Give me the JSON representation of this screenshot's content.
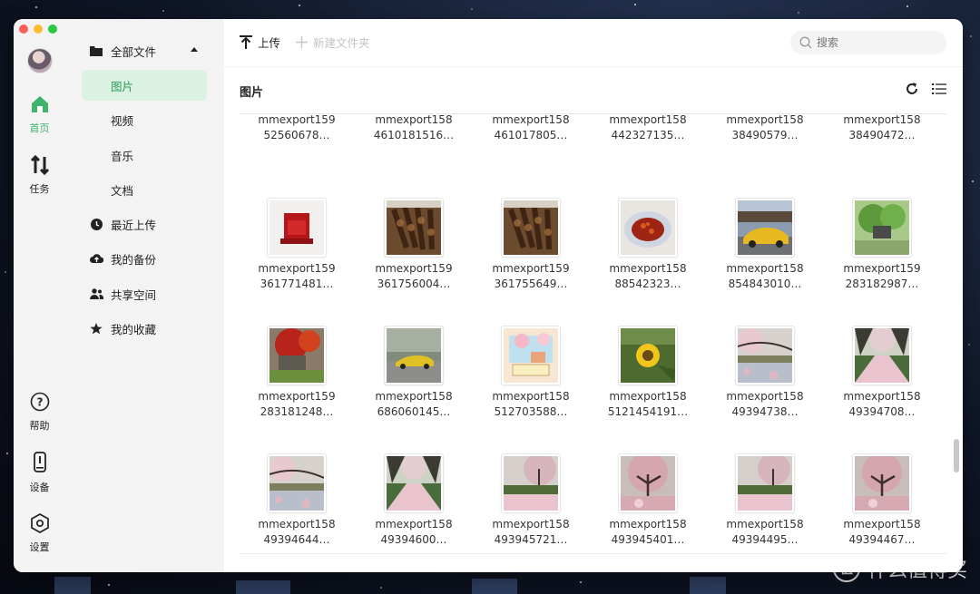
{
  "window": {
    "traffic_colors": [
      "#ff5f57",
      "#febc2e",
      "#28c840"
    ]
  },
  "rail": {
    "items": [
      {
        "label": "首页",
        "icon": "home-icon",
        "active": true
      },
      {
        "label": "任务",
        "icon": "transfer-icon",
        "active": false
      },
      {
        "label": "帮助",
        "icon": "help-icon",
        "active": false
      },
      {
        "label": "设备",
        "icon": "device-icon",
        "active": false
      },
      {
        "label": "设置",
        "icon": "settings-hex-icon",
        "active": false
      }
    ]
  },
  "sidebar": {
    "items": [
      {
        "label": "全部文件",
        "icon": "folder-icon"
      },
      {
        "label": "图片",
        "selected": true
      },
      {
        "label": "视频"
      },
      {
        "label": "音乐"
      },
      {
        "label": "文档"
      },
      {
        "label": "最近上传",
        "icon": "clock-icon"
      },
      {
        "label": "我的备份",
        "icon": "cloud-upload-icon"
      },
      {
        "label": "共享空间",
        "icon": "users-icon"
      },
      {
        "label": "我的收藏",
        "icon": "star-icon"
      }
    ]
  },
  "toolbar": {
    "upload_label": "上传",
    "new_folder_label": "新建文件夹",
    "search_placeholder": "搜索"
  },
  "main": {
    "section_title": "图片",
    "partial_row": [
      {
        "line1": "mmexport159",
        "line2": "52560678…"
      },
      {
        "line1": "mmexport158",
        "line2": "4610181516…"
      },
      {
        "line1": "mmexport158",
        "line2": "461017805…"
      },
      {
        "line1": "mmexport158",
        "line2": "442327135…"
      },
      {
        "line1": "mmexport158",
        "line2": "38490579…"
      },
      {
        "line1": "mmexport158",
        "line2": "38490472…"
      }
    ],
    "files": [
      {
        "line1": "mmexport159",
        "line2": "361771481…",
        "scene": "red-box"
      },
      {
        "line1": "mmexport159",
        "line2": "361756004…",
        "scene": "skewers"
      },
      {
        "line1": "mmexport159",
        "line2": "361755649…",
        "scene": "skewers"
      },
      {
        "line1": "mmexport158",
        "line2": "88542323…",
        "scene": "dish"
      },
      {
        "line1": "mmexport158",
        "line2": "854843010…",
        "scene": "yellow-car"
      },
      {
        "line1": "mmexport159",
        "line2": "283182987…",
        "scene": "park"
      },
      {
        "line1": "mmexport159",
        "line2": "283181248…",
        "scene": "red-tree"
      },
      {
        "line1": "mmexport158",
        "line2": "686060145…",
        "scene": "yellow-car2"
      },
      {
        "line1": "mmexport158",
        "line2": "512703588…",
        "scene": "drawing"
      },
      {
        "line1": "mmexport158",
        "line2": "5121454191…",
        "scene": "sunflower"
      },
      {
        "line1": "mmexport158",
        "line2": "49394738…",
        "scene": "blossom-lake"
      },
      {
        "line1": "mmexport158",
        "line2": "49394708…",
        "scene": "blossom-path"
      },
      {
        "line1": "mmexport158",
        "line2": "49394644…",
        "scene": "blossom-lake"
      },
      {
        "line1": "mmexport158",
        "line2": "49394600…",
        "scene": "blossom-path"
      },
      {
        "line1": "mmexport158",
        "line2": "493945721…",
        "scene": "blossom-lawn"
      },
      {
        "line1": "mmexport158",
        "line2": "493945401…",
        "scene": "blossom-tree"
      },
      {
        "line1": "mmexport158",
        "line2": "49394495…",
        "scene": "blossom-lawn"
      },
      {
        "line1": "mmexport158",
        "line2": "49394467…",
        "scene": "blossom-tree"
      }
    ]
  },
  "watermark": {
    "text": "什么值得买",
    "logo": "值"
  },
  "colors": {
    "accent": "#3fb26b",
    "selected_bg": "#dbf1e1"
  }
}
